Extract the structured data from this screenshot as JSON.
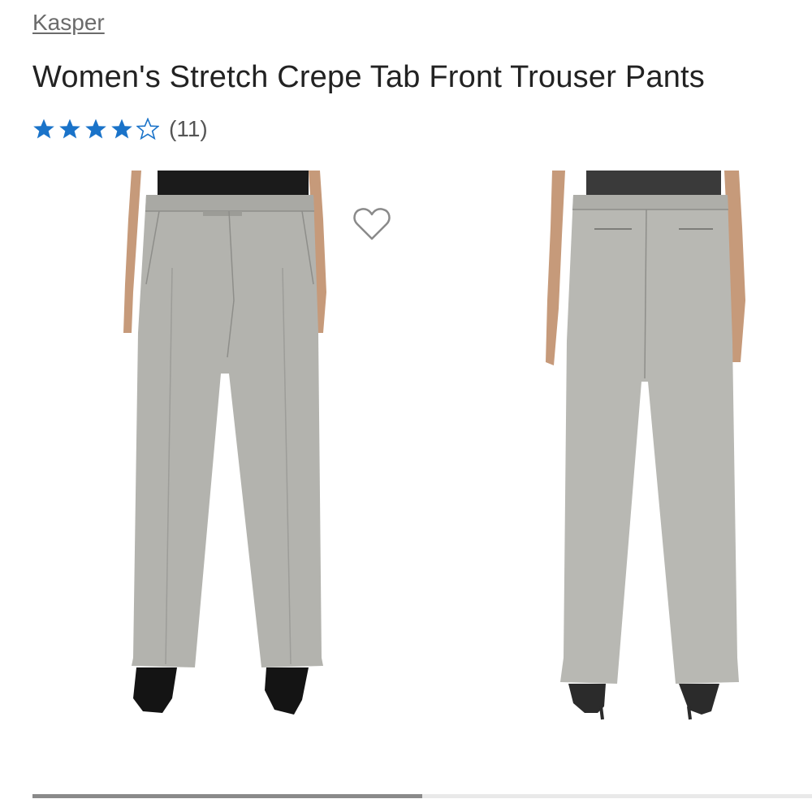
{
  "product": {
    "brand": "Kasper",
    "title": "Women's Stretch Crepe Tab Front Trouser Pants",
    "rating": {
      "stars": 4,
      "max": 5,
      "count_label": "(11)"
    }
  },
  "gallery": {
    "images": [
      {
        "view": "front"
      },
      {
        "view": "back"
      }
    ],
    "progress": 0.5
  },
  "colors": {
    "star": "#1a73c9",
    "fabric": "#b3b3ae",
    "text": "#222222",
    "muted": "#6b6b6b"
  },
  "icons": [
    "star-filled-icon",
    "star-outline-icon",
    "heart-outline-icon"
  ]
}
